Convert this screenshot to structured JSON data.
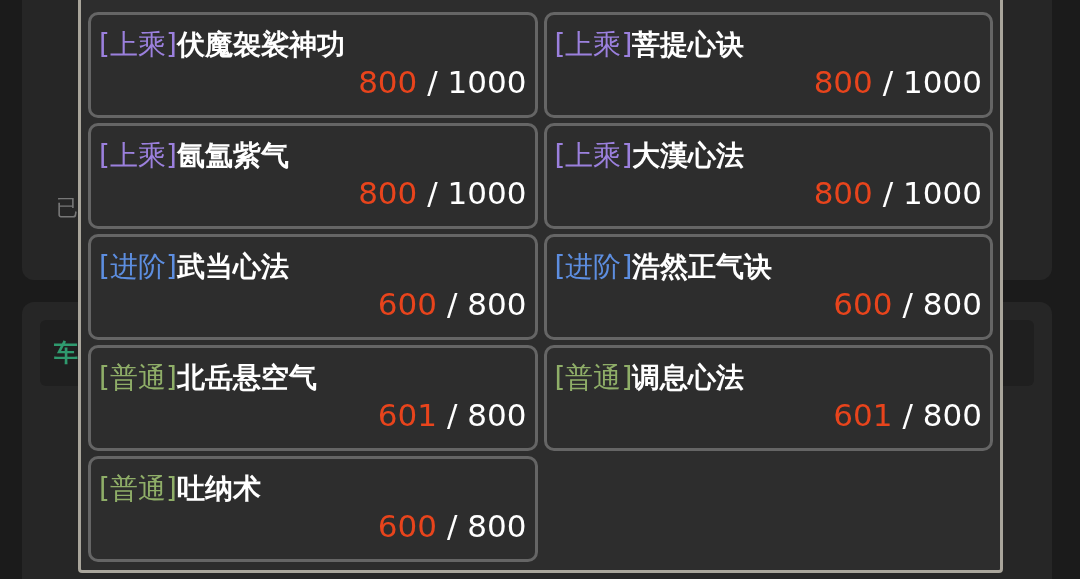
{
  "background": {
    "panel_hint": "已",
    "title_hint": "车"
  },
  "skills": [
    {
      "tier": "[上乘]",
      "kind": "top",
      "name": "伏魔袈裟神功",
      "current": "800",
      "total": "/ 1000"
    },
    {
      "tier": "[上乘]",
      "kind": "top",
      "name": "菩提心诀",
      "current": "800",
      "total": "/ 1000"
    },
    {
      "tier": "[上乘]",
      "kind": "top",
      "name": "氤氲紫气",
      "current": "800",
      "total": "/ 1000"
    },
    {
      "tier": "[上乘]",
      "kind": "top",
      "name": "大漢心法",
      "current": "800",
      "total": "/ 1000"
    },
    {
      "tier": "[进阶]",
      "kind": "advanced",
      "name": "武当心法",
      "current": "600",
      "total": "/ 800"
    },
    {
      "tier": "[进阶]",
      "kind": "advanced",
      "name": "浩然正气诀",
      "current": "600",
      "total": "/ 800"
    },
    {
      "tier": "[普通]",
      "kind": "common",
      "name": "北岳悬空气",
      "current": "601",
      "total": "/ 800"
    },
    {
      "tier": "[普通]",
      "kind": "common",
      "name": "调息心法",
      "current": "601",
      "total": "/ 800"
    },
    {
      "tier": "[普通]",
      "kind": "common",
      "name": "吐纳术",
      "current": "600",
      "total": "/ 800"
    }
  ]
}
